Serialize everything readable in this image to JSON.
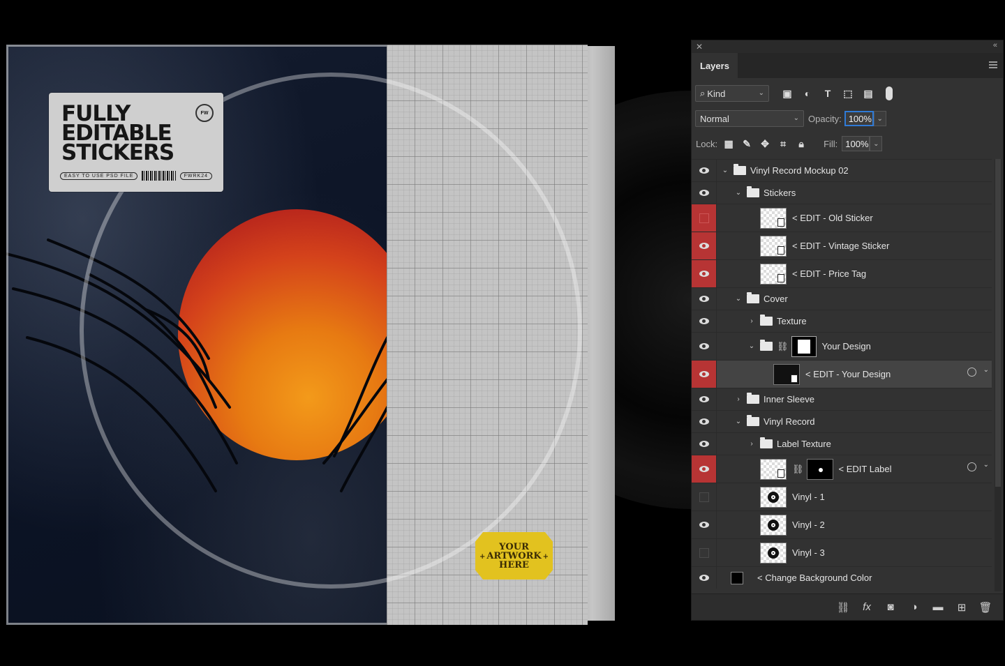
{
  "mockup": {
    "sticker": {
      "title": "FULLY\nEDITABLE\nSTICKERS",
      "badge_left": "EASY TO USE PSD FILE",
      "badge_right": "FWRK24",
      "mark": "FW"
    },
    "artwork_tag": "YOUR\nARTWORK\nHERE",
    "tag_bullet": "+"
  },
  "panel": {
    "close_glyph": "✕",
    "collapse_glyph": "«",
    "tab_label": "Layers",
    "filter": {
      "kind_label": "Kind",
      "search_glyph": "⌕"
    },
    "blend_mode": "Normal",
    "opacity_label": "Opacity:",
    "opacity_value": "100%",
    "lock_label": "Lock:",
    "fill_label": "Fill:",
    "fill_value": "100%",
    "layers": [
      {
        "name": "Vinyl Record Mockup 02",
        "type": "group",
        "indent": 0,
        "expanded": true,
        "visible": true,
        "red": false
      },
      {
        "name": "Stickers",
        "type": "group",
        "indent": 1,
        "expanded": true,
        "visible": true,
        "red": false
      },
      {
        "name": "< EDIT - Old Sticker",
        "type": "smart",
        "indent": 2,
        "visible": false,
        "red": true
      },
      {
        "name": "< EDIT - Vintage Sticker",
        "type": "smart",
        "indent": 2,
        "visible": true,
        "red": true
      },
      {
        "name": "< EDIT - Price Tag",
        "type": "smart",
        "indent": 2,
        "visible": true,
        "red": true
      },
      {
        "name": "Cover",
        "type": "group",
        "indent": 1,
        "expanded": true,
        "visible": true,
        "red": false
      },
      {
        "name": "Texture",
        "type": "group",
        "indent": 2,
        "expanded": false,
        "visible": true,
        "red": false
      },
      {
        "name": "Your Design",
        "type": "group-mask",
        "indent": 2,
        "expanded": true,
        "visible": true,
        "red": false
      },
      {
        "name": "< EDIT - Your Design",
        "type": "smart-selected",
        "indent": 3,
        "visible": true,
        "red": true
      },
      {
        "name": "Inner Sleeve",
        "type": "group",
        "indent": 1,
        "expanded": false,
        "visible": true,
        "red": false
      },
      {
        "name": "Vinyl Record",
        "type": "group",
        "indent": 1,
        "expanded": true,
        "visible": true,
        "red": false
      },
      {
        "name": "Label Texture",
        "type": "group",
        "indent": 2,
        "expanded": false,
        "visible": true,
        "red": false
      },
      {
        "name": "< EDIT Label",
        "type": "smart-mask",
        "indent": 2,
        "visible": true,
        "red": true
      },
      {
        "name": "Vinyl - 1",
        "type": "disc",
        "indent": 2,
        "visible": false,
        "red": false
      },
      {
        "name": "Vinyl - 2",
        "type": "disc",
        "indent": 2,
        "visible": true,
        "red": false
      },
      {
        "name": "Vinyl - 3",
        "type": "disc",
        "indent": 2,
        "visible": false,
        "red": false
      },
      {
        "name": "< Change Background Color",
        "type": "fill",
        "indent": 0,
        "visible": true,
        "red": false
      }
    ]
  },
  "colors": {
    "background": "#000000",
    "panel": "#323232",
    "visibility_red": "#b73434",
    "focus_blue": "#2f7ad6",
    "sun_orange": "#e77a12",
    "tag_yellow": "#e2c21f"
  }
}
